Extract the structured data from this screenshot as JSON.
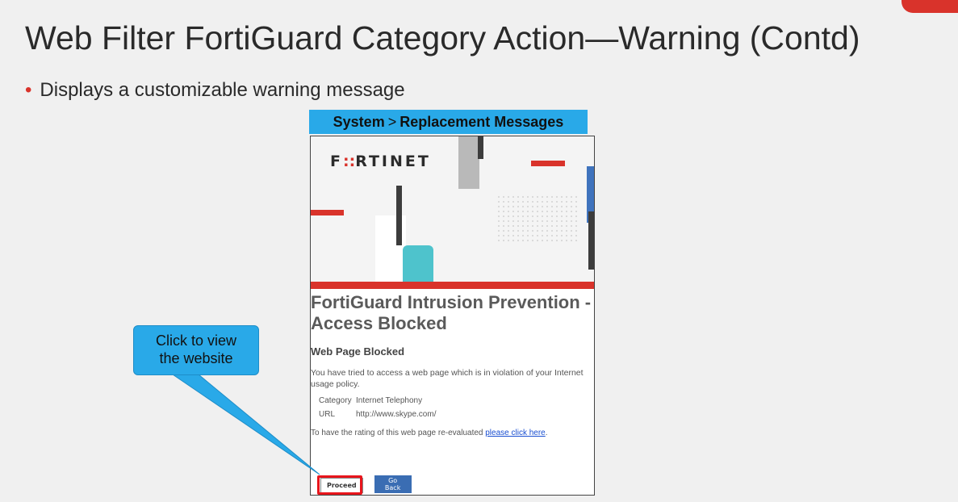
{
  "slide": {
    "title": "Web Filter FortiGuard Category Action—Warning (Contd)",
    "bullet": "Displays a customizable warning message"
  },
  "breadcrumb": {
    "part1": "System",
    "separator": ">",
    "part2": "Replacement Messages"
  },
  "page": {
    "logo": {
      "left": "F",
      "mark": "::",
      "right": "RTINET"
    },
    "heading": "FortiGuard Intrusion Prevention - Access Blocked",
    "subheading": "Web Page Blocked",
    "message": "You have tried to access a web page which is in violation of your Internet usage policy.",
    "details": [
      {
        "key": "Category",
        "value": "Internet Telephony"
      },
      {
        "key": "URL",
        "value": "http://www.skype.com/"
      }
    ],
    "rate_prefix": "To have the rating of this web page re-evaluated ",
    "rate_link": "please click here",
    "rate_suffix": ".",
    "proceed_label": "Proceed",
    "back_label": "Go Back"
  },
  "callout": {
    "line1": "Click to view",
    "line2": "the website"
  },
  "colors": {
    "accent_red": "#d9332b",
    "callout_blue": "#29a9e8",
    "button_blue": "#3a6db3"
  }
}
